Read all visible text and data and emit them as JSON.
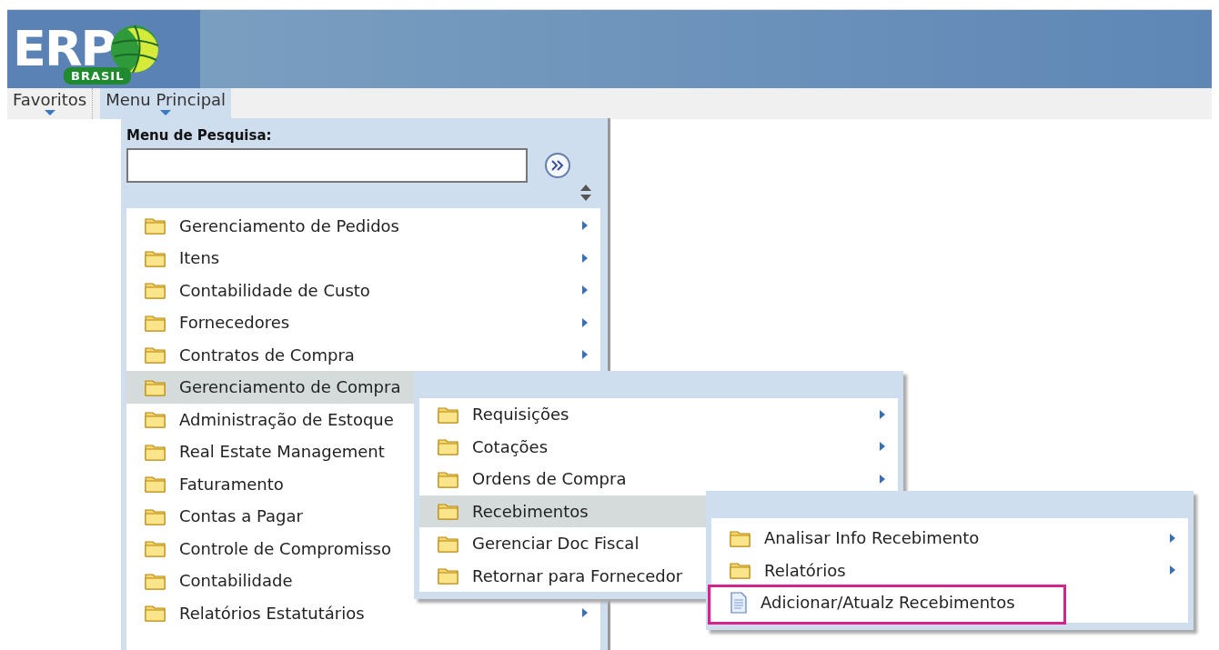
{
  "logo": {
    "text": "ERP",
    "subtext": "BRASIL"
  },
  "menubar": [
    {
      "label": "Favoritos",
      "selected": false
    },
    {
      "label": "Menu Principal",
      "selected": true
    }
  ],
  "search": {
    "label": "Menu de Pesquisa:"
  },
  "main_menu": [
    {
      "label": "Gerenciamento de Pedidos",
      "arrow": true,
      "selected": false
    },
    {
      "label": "Itens",
      "arrow": true,
      "selected": false
    },
    {
      "label": "Contabilidade de Custo",
      "arrow": true,
      "selected": false
    },
    {
      "label": "Fornecedores",
      "arrow": true,
      "selected": false
    },
    {
      "label": "Contratos de Compra",
      "arrow": true,
      "selected": false
    },
    {
      "label": "Gerenciamento de Compra",
      "arrow": false,
      "selected": true
    },
    {
      "label": "Administração de Estoque",
      "arrow": false,
      "selected": false
    },
    {
      "label": "Real Estate Management",
      "arrow": false,
      "selected": false
    },
    {
      "label": "Faturamento",
      "arrow": false,
      "selected": false
    },
    {
      "label": "Contas a Pagar",
      "arrow": false,
      "selected": false
    },
    {
      "label": "Controle de Compromisso",
      "arrow": false,
      "selected": false
    },
    {
      "label": "Contabilidade",
      "arrow": false,
      "selected": false
    },
    {
      "label": "Relatórios Estatutários",
      "arrow": true,
      "selected": false
    }
  ],
  "submenu": [
    {
      "label": "Requisições",
      "arrow": true,
      "selected": false
    },
    {
      "label": "Cotações",
      "arrow": true,
      "selected": false
    },
    {
      "label": "Ordens de Compra",
      "arrow": true,
      "selected": false
    },
    {
      "label": "Recebimentos",
      "arrow": false,
      "selected": true
    },
    {
      "label": "Gerenciar Doc Fiscal",
      "arrow": false,
      "selected": false
    },
    {
      "label": "Retornar para Fornecedor",
      "arrow": false,
      "selected": false
    }
  ],
  "submenu_2": [
    {
      "label": "Analisar Info Recebimento",
      "kind": "folder",
      "arrow": true,
      "selected": false,
      "highlighted": false
    },
    {
      "label": "Relatórios",
      "kind": "folder",
      "arrow": true,
      "selected": false,
      "highlighted": false
    },
    {
      "label": "Adicionar/Atualz Recebimentos",
      "kind": "page",
      "arrow": false,
      "selected": false,
      "highlighted": true
    }
  ]
}
